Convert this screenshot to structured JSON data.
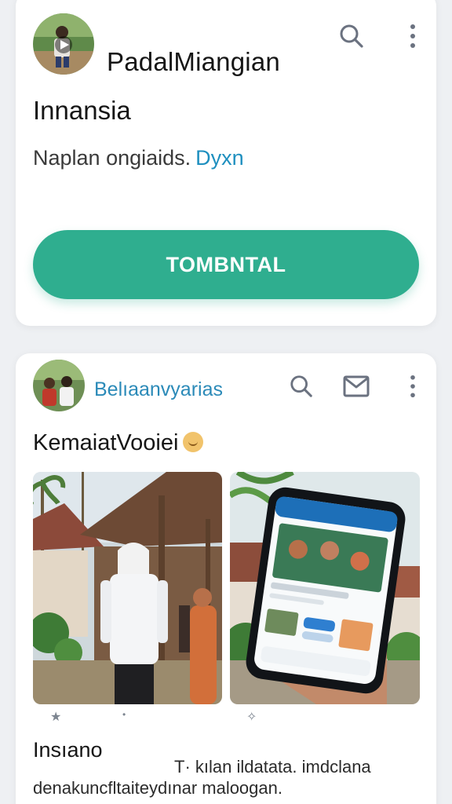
{
  "colors": {
    "accent": "#2fae8f",
    "link": "#1e8fbf",
    "background": "#eef0f3",
    "card": "#ffffff"
  },
  "card1": {
    "title": "PadalMiangian",
    "subtitle": "Innansia",
    "description": "Naplan ongiaids.",
    "link_text": "Dyxn",
    "cta_label": "TOMBNTAL",
    "icons": [
      "play-icon",
      "search-icon",
      "more-vertical-icon"
    ]
  },
  "card2": {
    "author": "Belıaanvyarias",
    "post_title": "KemaiatVooiei",
    "icons": [
      "search-icon",
      "mail-icon",
      "more-vertical-icon",
      "smiley-emoji-icon"
    ],
    "photos": [
      "village-man-photo",
      "phone-app-photo"
    ],
    "footer_title": "Insıano",
    "footer_caption": "T· kılan ildatata. imdclana",
    "footer_desc": "denakuncfltaiteydınar maloogan."
  }
}
